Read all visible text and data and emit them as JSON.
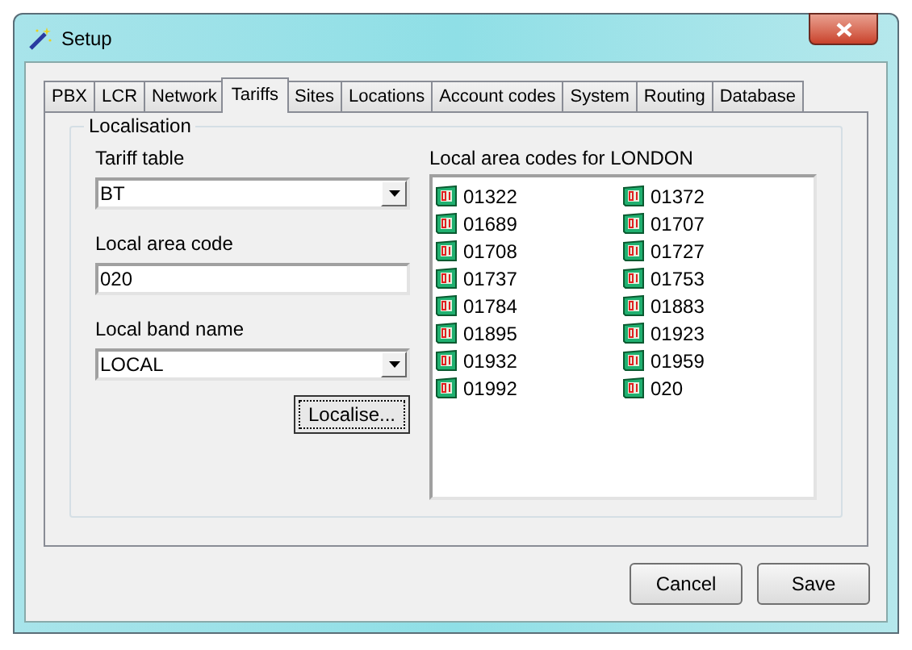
{
  "window": {
    "title": "Setup"
  },
  "tabs": [
    {
      "label": "PBX",
      "selected": false
    },
    {
      "label": "LCR",
      "selected": false
    },
    {
      "label": "Network",
      "selected": false
    },
    {
      "label": "Tariffs",
      "selected": true
    },
    {
      "label": "Sites",
      "selected": false
    },
    {
      "label": "Locations",
      "selected": false
    },
    {
      "label": "Account codes",
      "selected": false
    },
    {
      "label": "System",
      "selected": false
    },
    {
      "label": "Routing",
      "selected": false
    },
    {
      "label": "Database",
      "selected": false
    }
  ],
  "group": {
    "title": "Localisation",
    "fields": [
      {
        "kind": "dropdown",
        "label": "Tariff table",
        "value": "BT"
      },
      {
        "kind": "text",
        "label": "Local area code",
        "value": "020"
      },
      {
        "kind": "dropdown",
        "label": "Local band name",
        "value": "LOCAL"
      }
    ],
    "localise_button": "Localise...",
    "list_title": "Local area codes for LONDON",
    "codes": [
      "01322",
      "01372",
      "01689",
      "01707",
      "01708",
      "01727",
      "01737",
      "01753",
      "01784",
      "01883",
      "01895",
      "01923",
      "01932",
      "01959",
      "01992",
      "020"
    ]
  },
  "buttons": [
    "Cancel",
    "Save"
  ]
}
